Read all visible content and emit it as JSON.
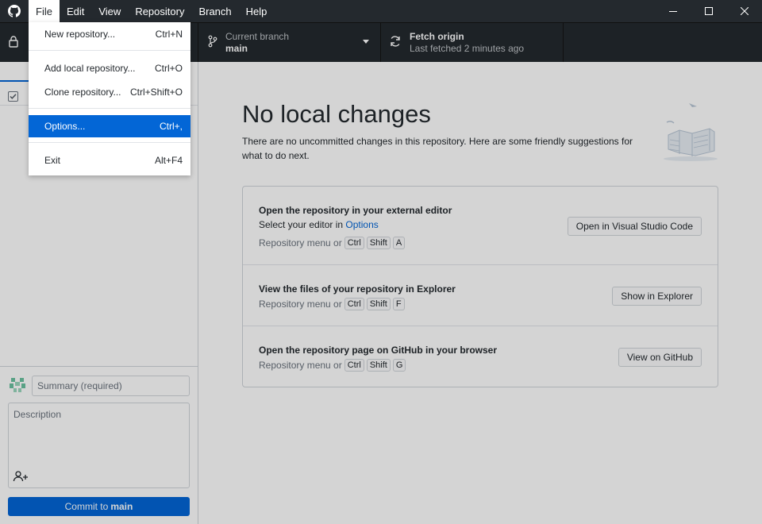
{
  "menubar": {
    "items": [
      {
        "label": "File",
        "active": true
      },
      {
        "label": "Edit"
      },
      {
        "label": "View"
      },
      {
        "label": "Repository"
      },
      {
        "label": "Branch"
      },
      {
        "label": "Help"
      }
    ]
  },
  "toolbar": {
    "branch": {
      "title": "Current branch",
      "value": "main"
    },
    "fetch": {
      "title": "Fetch origin",
      "subtitle": "Last fetched 2 minutes ago"
    }
  },
  "file_menu": {
    "items": [
      {
        "label": "New repository...",
        "shortcut": "Ctrl+N"
      },
      {
        "label": "Add local repository...",
        "shortcut": "Ctrl+O"
      },
      {
        "label": "Clone repository...",
        "shortcut": "Ctrl+Shift+O"
      },
      {
        "label": "Options...",
        "shortcut": "Ctrl+,"
      },
      {
        "label": "Exit",
        "shortcut": "Alt+F4"
      }
    ]
  },
  "commit": {
    "summary_placeholder": "Summary (required)",
    "description_placeholder": "Description",
    "button_prefix": "Commit to",
    "button_branch": "main"
  },
  "main": {
    "title": "No local changes",
    "description": "There are no uncommitted changes in this repository. Here are some friendly suggestions for what to do next.",
    "actions": [
      {
        "title": "Open the repository in your external editor",
        "subtitle_prefix": "Select your editor in",
        "subtitle_link": "Options",
        "shortcut_prefix": "Repository menu or",
        "keys": [
          "Ctrl",
          "Shift",
          "A"
        ],
        "button": "Open in Visual Studio Code"
      },
      {
        "title": "View the files of your repository in Explorer",
        "shortcut_prefix": "Repository menu or",
        "keys": [
          "Ctrl",
          "Shift",
          "F"
        ],
        "button": "Show in Explorer"
      },
      {
        "title": "Open the repository page on GitHub in your browser",
        "shortcut_prefix": "Repository menu or",
        "keys": [
          "Ctrl",
          "Shift",
          "G"
        ],
        "button": "View on GitHub"
      }
    ]
  },
  "colors": {
    "accent": "#0366d6",
    "titlebar": "#24292e"
  }
}
